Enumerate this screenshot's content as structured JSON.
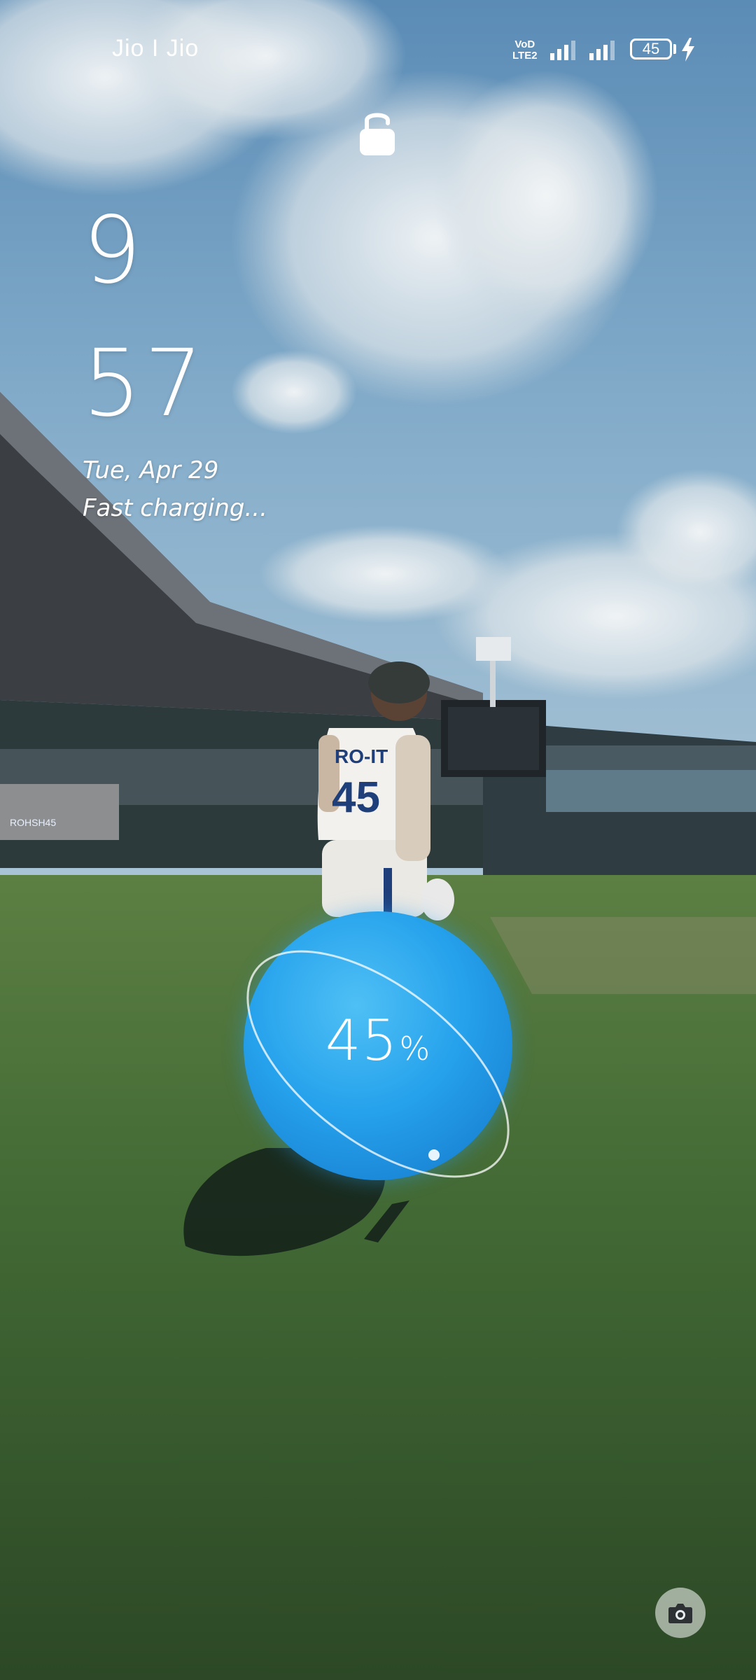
{
  "status_bar": {
    "carrier": "Jio I Jio",
    "volte_top": "VoD",
    "volte_bottom": "LTE2",
    "battery_level": "45",
    "icons": [
      "signal-1-icon",
      "signal-2-icon",
      "battery-icon",
      "charging-bolt-icon"
    ]
  },
  "lock_screen": {
    "lock_icon": "padlock-unlocked-icon",
    "clock_hour": "9",
    "clock_minute": "57",
    "date": "Tue, Apr 29",
    "charging_status": "Fast charging..."
  },
  "charging_orb": {
    "percent_value": "45",
    "percent_sign": "%",
    "color": "#26a2ec"
  },
  "wallpaper": {
    "jersey_name": "RO-IT",
    "jersey_number": "45",
    "watermark": "ROHSH45"
  },
  "shortcuts": {
    "camera_icon": "camera-icon"
  }
}
